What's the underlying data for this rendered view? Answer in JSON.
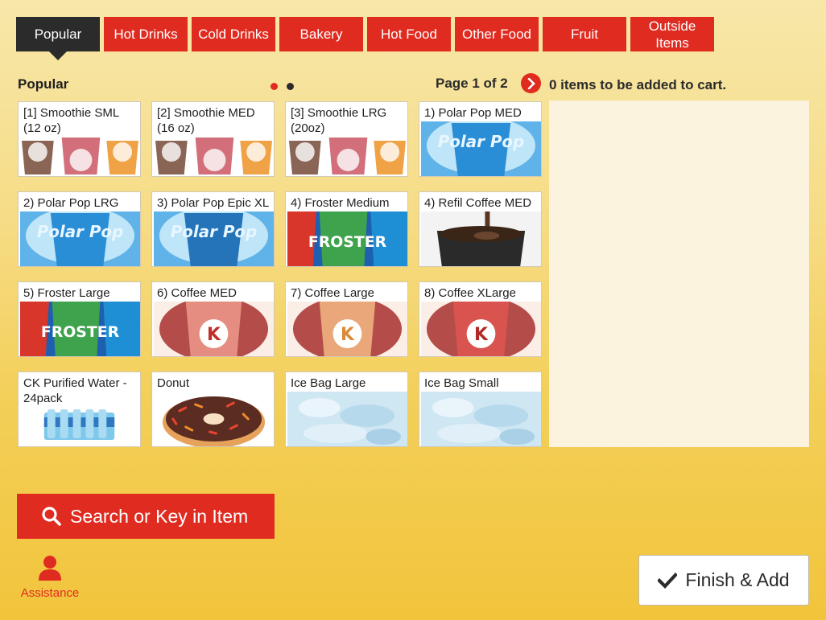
{
  "tabs": [
    {
      "label": "Popular",
      "active": true
    },
    {
      "label": "Hot Drinks"
    },
    {
      "label": "Cold Drinks"
    },
    {
      "label": "Bakery"
    },
    {
      "label": "Hot Food"
    },
    {
      "label": "Other Food"
    },
    {
      "label": "Fruit"
    },
    {
      "label": "Outside Items"
    }
  ],
  "section": {
    "title": "Popular"
  },
  "pagination": {
    "label": "Page 1 of 2",
    "current_page": 1,
    "total_pages": 2
  },
  "cart": {
    "status": "0 items to be added to cart."
  },
  "products": [
    {
      "label": "[1] Smoothie SML (12 oz)",
      "image": "smoothie-cups"
    },
    {
      "label": "[2] Smoothie MED (16 oz)",
      "image": "smoothie-cups"
    },
    {
      "label": "[3] Smoothie LRG (20oz)",
      "image": "smoothie-cups"
    },
    {
      "label": "1) Polar Pop MED",
      "image": "polar-pop-cup",
      "brand_text": "Polar Pop"
    },
    {
      "label": "2) Polar Pop LRG",
      "image": "polar-pop-cup",
      "brand_text": "Polar Pop"
    },
    {
      "label": "3) Polar Pop Epic XL",
      "image": "polar-pop-cup",
      "brand_text": "Polar Pop"
    },
    {
      "label": "4) Froster Medium",
      "image": "froster-cups",
      "brand_text": "FROSTER"
    },
    {
      "label": "4) Refil Coffee MED",
      "image": "coffee-pour"
    },
    {
      "label": "5) Froster Large",
      "image": "froster-cups",
      "brand_text": "FROSTER"
    },
    {
      "label": "6) Coffee MED",
      "image": "circle-k-coffee-cup",
      "brand_text": "K"
    },
    {
      "label": "7) Coffee Large",
      "image": "circle-k-coffee-cup",
      "brand_text": "K"
    },
    {
      "label": "8) Coffee XLarge",
      "image": "circle-k-coffee-cup",
      "brand_text": "K"
    },
    {
      "label": "CK Purified Water - 24pack",
      "image": "water-bottle-pack"
    },
    {
      "label": "Donut",
      "image": "sprinkle-donut"
    },
    {
      "label": "Ice Bag Large",
      "image": "ice-bag"
    },
    {
      "label": "Ice Bag Small",
      "image": "ice-bag"
    }
  ],
  "search": {
    "label": "Search or Key in Item",
    "icon": "search-icon"
  },
  "assistance": {
    "label": "Assistance",
    "icon": "person-icon"
  },
  "finish": {
    "label": "Finish & Add",
    "icon": "checkmark-icon"
  },
  "colors": {
    "accent": "#e02b20",
    "dark": "#2b2b2b",
    "background": "#f5d46a"
  }
}
